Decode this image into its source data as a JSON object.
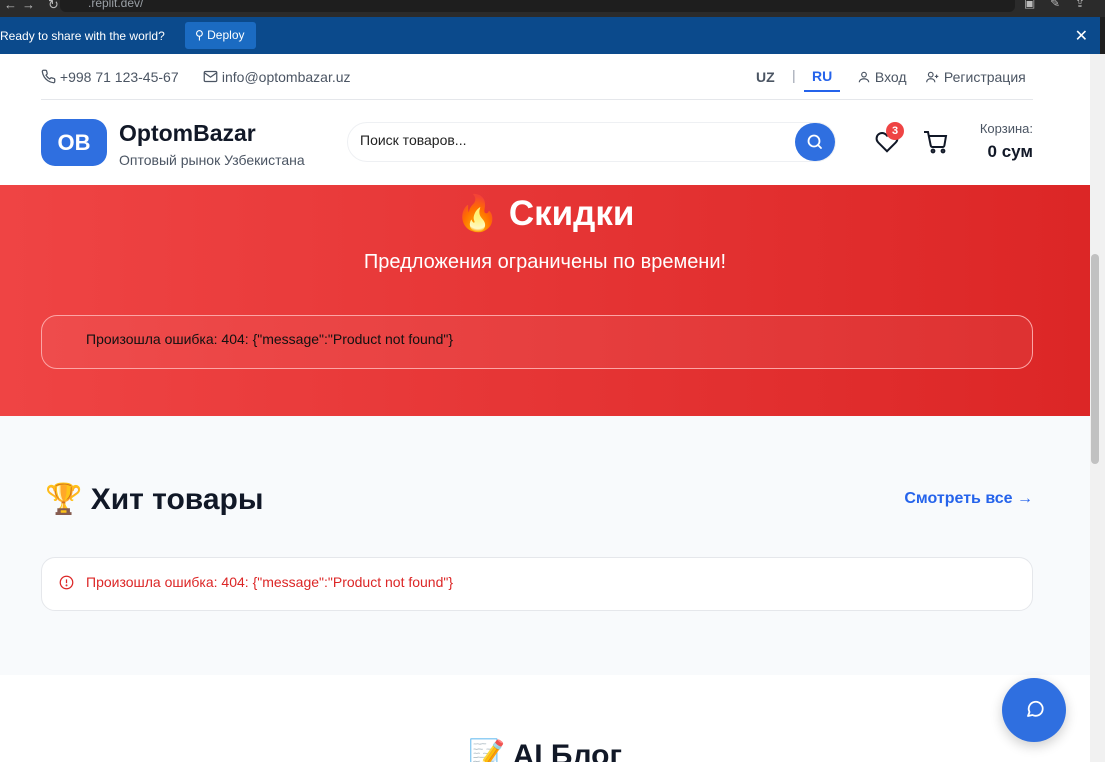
{
  "browser": {
    "url": ".replit.dev/"
  },
  "banner": {
    "message": "Ready to share with the world?",
    "deploy_label": "Deploy",
    "close_glyph": "✕"
  },
  "topbar": {
    "phone": "+998 71 123-45-67",
    "email": "info@optombazar.uz",
    "lang_uz": "UZ",
    "lang_ru": "RU",
    "separator": "|",
    "login": "Вход",
    "register": "Регистрация"
  },
  "header": {
    "logo_initials": "OB",
    "logo_name": "OptomBazar",
    "logo_subtitle": "Оптовый рынок Узбекистана",
    "search_placeholder": "Поиск товаров...",
    "wishlist_count": "3",
    "cart_label": "Корзина:",
    "cart_total": "0 сум"
  },
  "sale": {
    "icon": "🔥",
    "title": "Скидки",
    "subtitle": "Предложения ограничены по времени!",
    "error": "Произошла ошибка: 404: {\"message\":\"Product not found\"}"
  },
  "hits": {
    "icon": "🏆",
    "title": "Хит товары",
    "view_all": "Смотреть все →",
    "error": "Произошла ошибка: 404: {\"message\":\"Product not found\"}"
  },
  "blog": {
    "icon": "📝",
    "title": "AI Блог"
  },
  "colors": {
    "primary": "#2f6fe0",
    "banner": "#0b4a8c",
    "sale_red": "#ef4444",
    "error_red": "#dc2626"
  },
  "icons": [
    "phone-icon",
    "mail-icon",
    "user-icon",
    "user-plus-icon",
    "search-icon",
    "heart-icon",
    "cart-icon",
    "alert-circle-icon",
    "chat-icon",
    "close-icon",
    "deploy-icon"
  ]
}
